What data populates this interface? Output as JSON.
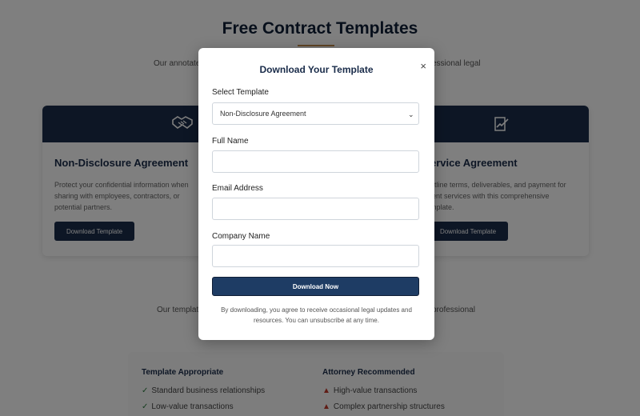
{
  "page": {
    "title": "Free Contract Templates",
    "intro_left": "Our annotate",
    "intro_right": "essional legal",
    "middle_left": "Our template",
    "middle_right": "professional"
  },
  "cards": [
    {
      "icon": "handshake-icon",
      "title": "Non-Disclosure Agreement",
      "description": "Protect your confidential information when sharing with employees, contractors, or potential partners.",
      "button": "Download Template"
    },
    {
      "icon": "document-signature-icon",
      "title": "ervice Agreement",
      "description_lines": [
        "utline terms, deliverables, and payment for",
        "ient services with this comprehensive",
        "mplate."
      ],
      "button": "Download Template"
    }
  ],
  "comparison": {
    "template_title": "Template Appropriate",
    "template_items": [
      "Standard business relationships",
      "Low-value transactions"
    ],
    "attorney_title": "Attorney Recommended",
    "attorney_items": [
      "High-value transactions",
      "Complex partnership structures"
    ]
  },
  "modal": {
    "title": "Download Your Template",
    "close": "×",
    "select_label": "Select Template",
    "selected_template": "Non-Disclosure Agreement",
    "full_name_label": "Full Name",
    "full_name_value": "",
    "email_label": "Email Address",
    "email_value": "",
    "company_label": "Company Name",
    "company_value": "",
    "submit": "Download Now",
    "disclaimer_line1": "By downloading, you agree to receive occasional legal updates and",
    "disclaimer_line2": "resources. You can unsubscribe at any time."
  },
  "colors": {
    "navy": "#1a2c4a",
    "button": "#1e3c64",
    "accent": "#c0894a"
  }
}
